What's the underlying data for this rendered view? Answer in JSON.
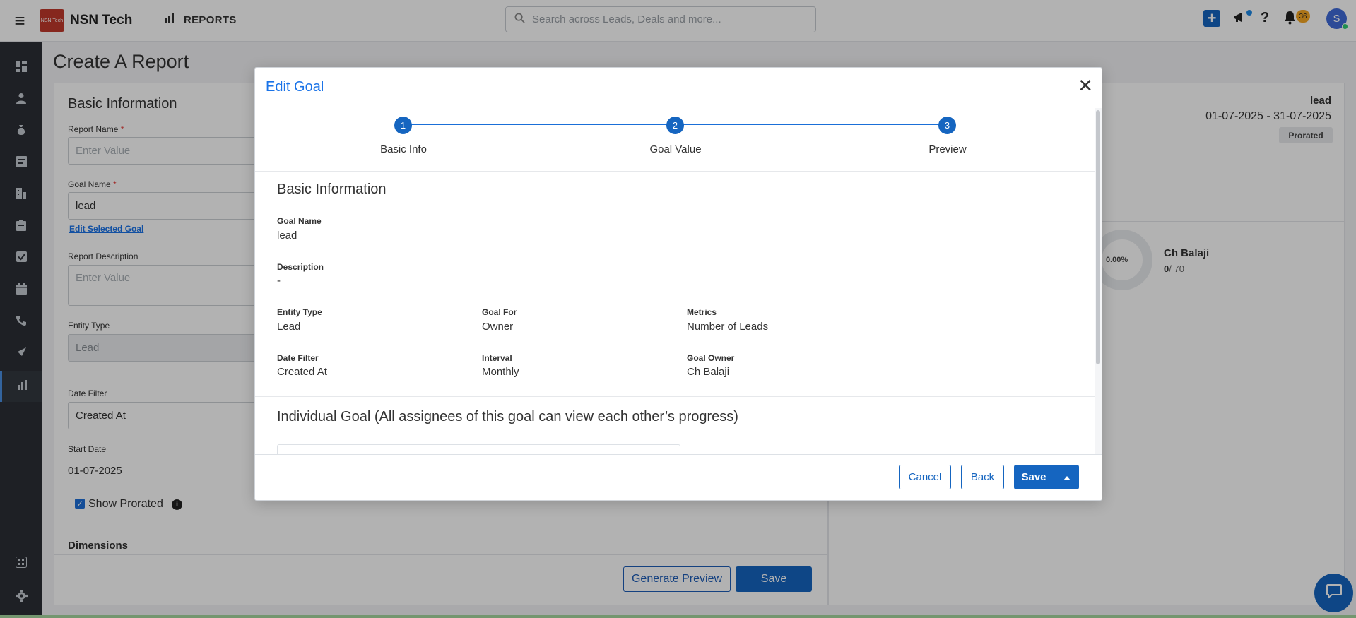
{
  "topbar": {
    "brand_name": "NSN Tech",
    "brand_logo_text": "NSN Tech",
    "section": "REPORTS",
    "search_placeholder": "Search across Leads, Deals and more...",
    "notification_count": "36",
    "avatar_initial": "S"
  },
  "sidebar": {
    "icons": [
      "dashboard-icon",
      "person-icon",
      "money-bag-icon",
      "contact-card-icon",
      "building-icon",
      "clipboard-icon",
      "checkbox-icon",
      "calendar-icon",
      "phone-icon",
      "campaign-icon",
      "reports-icon",
      "apps-icon",
      "settings-icon"
    ],
    "active": "reports-icon"
  },
  "page": {
    "title": "Create A Report",
    "form": {
      "section_title": "Basic Information",
      "report_name_label": "Report Name",
      "report_name_placeholder": "Enter Value",
      "goal_name_label": "Goal Name",
      "goal_name_value": "lead",
      "edit_goal_link": "Edit Selected Goal",
      "report_description_label": "Report Description",
      "report_description_placeholder": "Enter Value",
      "entity_type_label": "Entity Type",
      "entity_type_value": "Lead",
      "date_filter_label": "Date Filter",
      "date_filter_value": "Created At",
      "start_date_label": "Start Date",
      "start_date_value": "01-07-2025",
      "show_prorated_label": "Show Prorated",
      "dimensions_label": "Dimensions",
      "required_mark": "*"
    },
    "actions": {
      "generate_preview": "Generate Preview",
      "save": "Save"
    },
    "preview": {
      "goal_title": "lead",
      "date_range": "01-07-2025 - 31-07-2025",
      "badge": "Prorated",
      "progress_percent": "0.00%",
      "owner_name": "Ch Balaji",
      "achieved": "0",
      "target": "/ 70"
    }
  },
  "modal": {
    "title": "Edit Goal",
    "steps": [
      {
        "number": "1",
        "label": "Basic Info"
      },
      {
        "number": "2",
        "label": "Goal Value"
      },
      {
        "number": "3",
        "label": "Preview"
      }
    ],
    "basic_info": {
      "title": "Basic Information",
      "goal_name_label": "Goal Name",
      "goal_name_value": "lead",
      "description_label": "Description",
      "description_value": "-",
      "entity_type_label": "Entity Type",
      "entity_type_value": "Lead",
      "goal_for_label": "Goal For",
      "goal_for_value": "Owner",
      "metrics_label": "Metrics",
      "metrics_value": "Number of Leads",
      "date_filter_label": "Date Filter",
      "date_filter_value": "Created At",
      "interval_label": "Interval",
      "interval_value": "Monthly",
      "goal_owner_label": "Goal Owner",
      "goal_owner_value": "Ch Balaji"
    },
    "individual_goal_title": "Individual Goal (All assignees of this goal can view each other’s progress)",
    "footer": {
      "cancel": "Cancel",
      "back": "Back",
      "save": "Save"
    }
  }
}
